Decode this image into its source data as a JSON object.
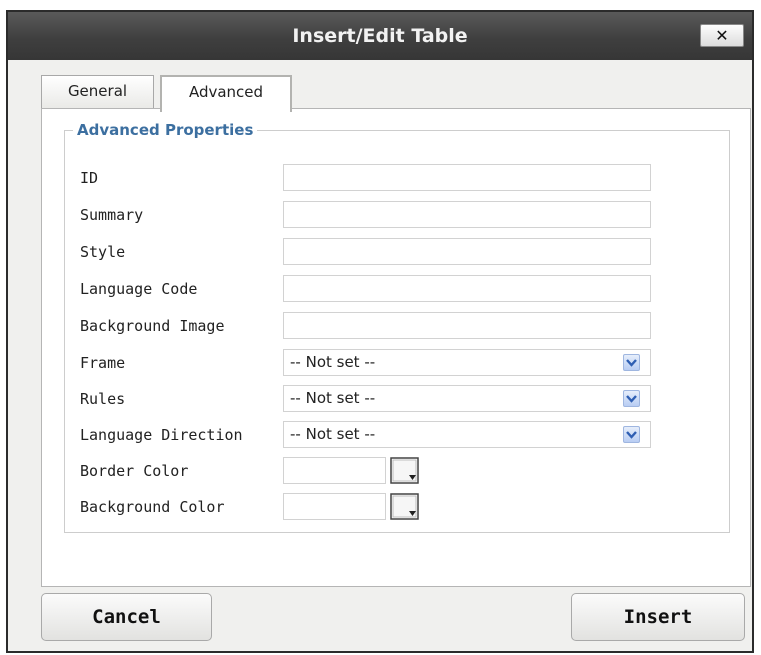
{
  "dialog": {
    "title": "Insert/Edit Table",
    "close_label": "✕"
  },
  "tabs": [
    {
      "label": "General",
      "active": false
    },
    {
      "label": "Advanced",
      "active": true
    }
  ],
  "advanced": {
    "legend": "Advanced Properties",
    "fields": {
      "id": {
        "label": "ID",
        "value": ""
      },
      "summary": {
        "label": "Summary",
        "value": ""
      },
      "style": {
        "label": "Style",
        "value": ""
      },
      "language_code": {
        "label": "Language Code",
        "value": ""
      },
      "background_image": {
        "label": "Background Image",
        "value": ""
      },
      "frame": {
        "label": "Frame",
        "value": "-- Not set --"
      },
      "rules": {
        "label": "Rules",
        "value": "-- Not set --"
      },
      "language_direction": {
        "label": "Language Direction",
        "value": "-- Not set --"
      },
      "border_color": {
        "label": "Border Color",
        "value": ""
      },
      "background_color": {
        "label": "Background Color",
        "value": ""
      }
    }
  },
  "buttons": {
    "cancel": "Cancel",
    "insert": "Insert"
  },
  "icons": {
    "select_arrow": "chevron-down-icon",
    "color_picker": "color-picker-icon",
    "close": "close-icon"
  },
  "colors": {
    "title_bar": "#3f3f3f",
    "legend_text": "#3c6fa0",
    "select_arrow": "#b8cdf3"
  }
}
